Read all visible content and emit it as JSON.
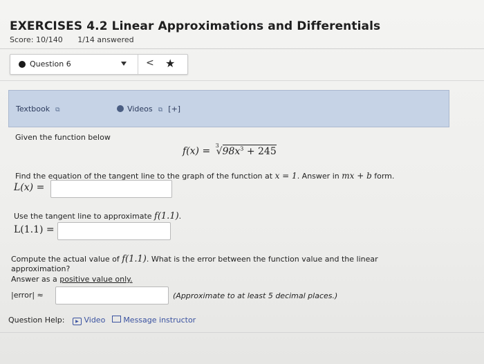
{
  "header": {
    "title": "EXERCISES 4.2 Linear Approximations and Differentials",
    "score": "Score: 10/140",
    "answered": "1/14 answered"
  },
  "question_nav": {
    "selected": "Question 6",
    "prev_glyph": "<",
    "star_glyph": "★"
  },
  "resources": {
    "textbook": "Textbook",
    "videos": "Videos",
    "expand": "[+]"
  },
  "problem": {
    "intro": "Given the function below",
    "function_lhs": "f(x) =",
    "radical_index": "3",
    "radicand": "98x",
    "radicand_exp": "3",
    "radicand_tail": " + 245",
    "part1_prefix": "Find the equation of the tangent line to the graph of the function at",
    "part1_math": "x = 1",
    "part1_middle": ". Answer in",
    "part1_form": "mx + b",
    "part1_suffix": "form.",
    "part1_label": "L(x) =",
    "part1_value": "",
    "part2_prefix": "Use the tangent line to approximate",
    "part2_math": "f(1.1)",
    "part2_suffix": ".",
    "part2_label": "L(1.1) =",
    "part2_value": "",
    "part3_prefix": "Compute the actual value of",
    "part3_math": "f(1.1)",
    "part3_suffix": ". What is the error between the function value and the linear",
    "part3_line2": "approximation?",
    "part3_line3_prefix": "Answer as a",
    "part3_line3_link": "positive value only.",
    "part3_label": "|error| ≈",
    "part3_value": "",
    "part3_note": "(Approximate to at least 5 decimal places.)"
  },
  "help": {
    "label": "Question Help:",
    "video": "Video",
    "message": "Message instructor"
  }
}
